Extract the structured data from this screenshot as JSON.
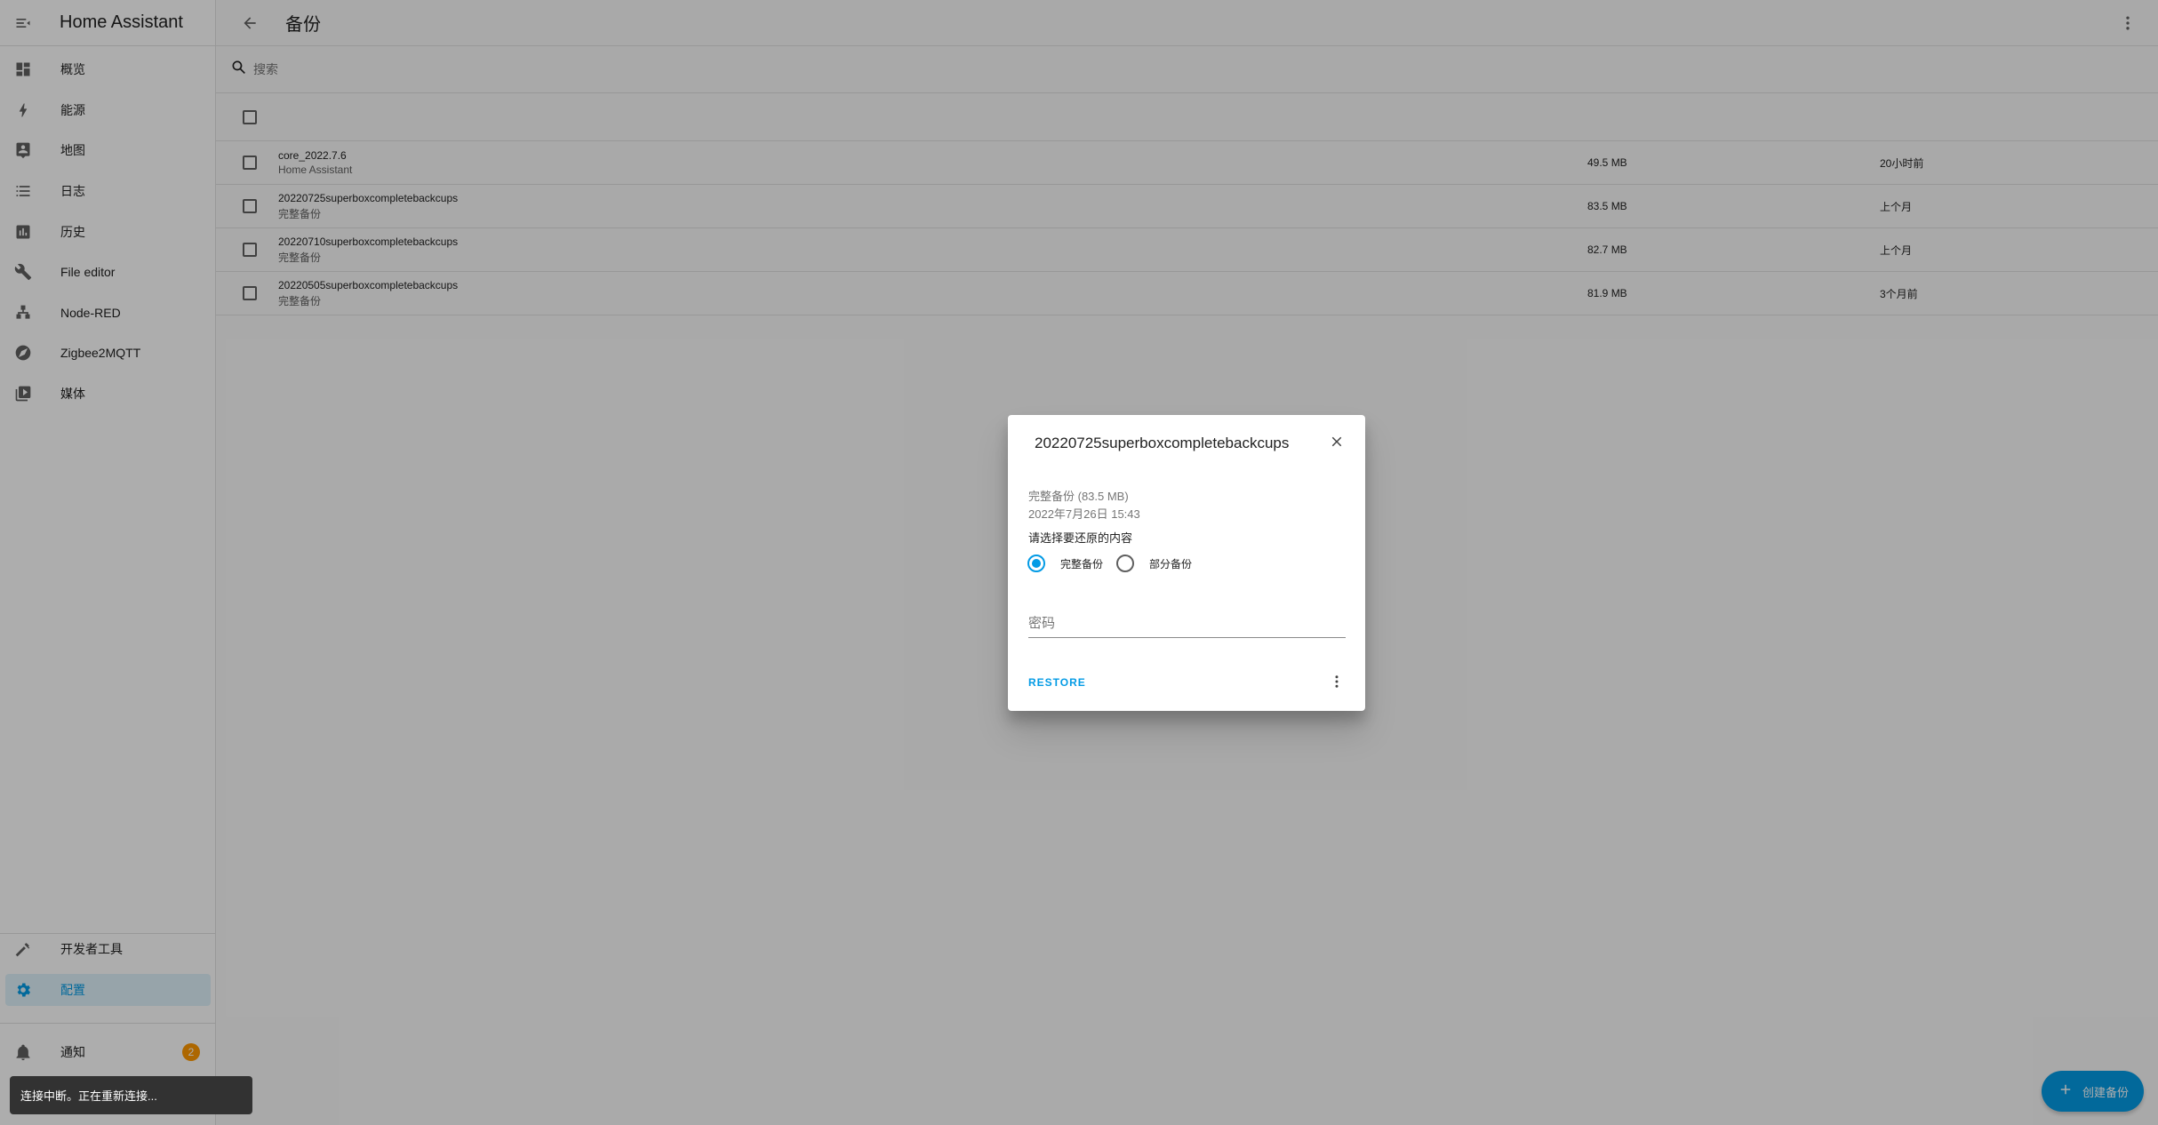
{
  "app": {
    "title": "Home Assistant"
  },
  "sidebar": {
    "items": [
      {
        "label": "概览",
        "icon": "dashboard-icon"
      },
      {
        "label": "能源",
        "icon": "lightning-icon"
      },
      {
        "label": "地图",
        "icon": "map-person-icon"
      },
      {
        "label": "日志",
        "icon": "list-icon"
      },
      {
        "label": "历史",
        "icon": "bar-chart-icon"
      },
      {
        "label": "File editor",
        "icon": "wrench-icon"
      },
      {
        "label": "Node-RED",
        "icon": "sitemap-icon"
      },
      {
        "label": "Zigbee2MQTT",
        "icon": "compass-icon"
      },
      {
        "label": "媒体",
        "icon": "media-icon"
      }
    ],
    "bottom": [
      {
        "label": "开发者工具",
        "icon": "hammer-icon"
      },
      {
        "label": "配置",
        "icon": "cog-icon"
      }
    ],
    "notifications": {
      "label": "通知",
      "count": "2"
    }
  },
  "header": {
    "title": "备份"
  },
  "search": {
    "placeholder": "搜索"
  },
  "backups": [
    {
      "name": "core_2022.7.6",
      "type": "Home Assistant",
      "size": "49.5 MB",
      "date": "20小时前"
    },
    {
      "name": "20220725superboxcompletebackcups",
      "type": "完整备份",
      "size": "83.5 MB",
      "date": "上个月"
    },
    {
      "name": "20220710superboxcompletebackcups",
      "type": "完整备份",
      "size": "82.7 MB",
      "date": "上个月"
    },
    {
      "name": "20220505superboxcompletebackcups",
      "type": "完整备份",
      "size": "81.9 MB",
      "date": "3个月前"
    }
  ],
  "dialog": {
    "title": "20220725superboxcompletebackcups",
    "type_size": "完整备份 (83.5 MB)",
    "date": "2022年7月26日 15:43",
    "prompt": "请选择要还原的内容",
    "option_full": "完整备份",
    "option_partial": "部分备份",
    "selected": "完整备份",
    "password_placeholder": "密码",
    "restore_label": "RESTORE"
  },
  "fab": {
    "label": "创建备份"
  },
  "toast": {
    "text": "连接中断。正在重新连接..."
  },
  "colors": {
    "accent": "#039be5",
    "badge": "#ff9800",
    "scrim": "rgba(0,0,0,0.32)"
  }
}
